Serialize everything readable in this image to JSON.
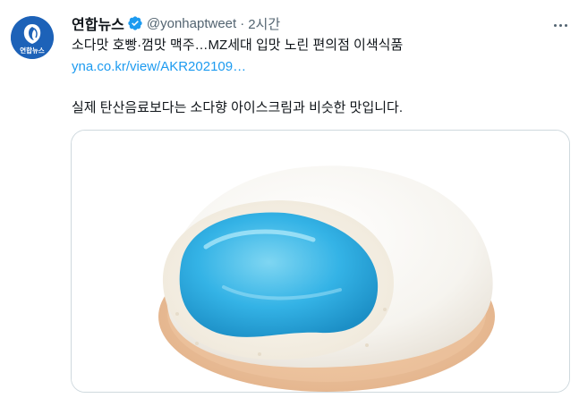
{
  "tweet": {
    "display_name": "연합뉴스",
    "handle": "@yonhaptweet",
    "separator": "·",
    "time": "2시간",
    "line1": "소다맛 호빵·껌맛 맥주…MZ세대 입맛 노린 편의점 이색식품",
    "link": "yna.co.kr/view/AKR202109…",
    "line2": "실제 탄산음료보다는 소다향 아이스크림과 비슷한 맛입니다."
  },
  "avatar": {
    "logo_text": "연합뉴스",
    "bg_color": "#1d62b8"
  },
  "icons": {
    "verified": "verified-badge-icon",
    "more": "more-options-icon"
  },
  "colors": {
    "text": "#0f1419",
    "secondary": "#536471",
    "link": "#1d9bf0",
    "verified": "#1d9bf0"
  }
}
